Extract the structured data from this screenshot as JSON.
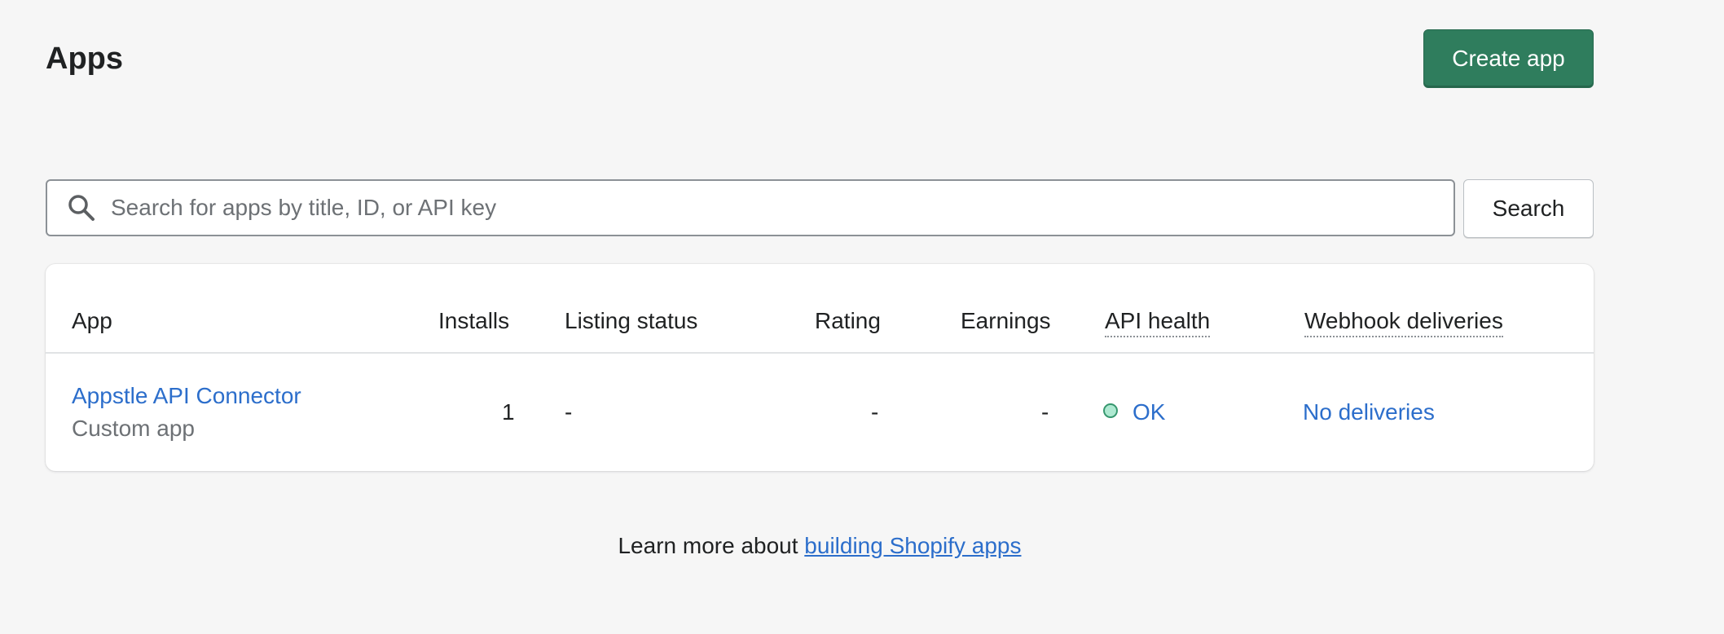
{
  "page": {
    "title": "Apps",
    "create_button_label": "Create app"
  },
  "search": {
    "placeholder": "Search for apps by title, ID, or API key",
    "value": "",
    "button_label": "Search",
    "icon": "search-icon"
  },
  "table": {
    "columns": {
      "app": "App",
      "installs": "Installs",
      "listing_status": "Listing status",
      "rating": "Rating",
      "earnings": "Earnings",
      "api_health": "API health",
      "webhook_deliveries": "Webhook deliveries"
    },
    "rows": [
      {
        "name": "Appstle API Connector",
        "type": "Custom app",
        "installs": "1",
        "listing_status": "-",
        "rating": "-",
        "earnings": "-",
        "api_health": "OK",
        "webhook_deliveries": "No deliveries"
      }
    ]
  },
  "footer": {
    "prefix": "Learn more about ",
    "link_text": "building Shopify apps"
  },
  "colors": {
    "primary_button": "#2f7d5d",
    "link": "#2c6ecb",
    "status_ok": "#36976e",
    "background": "#f6f6f6"
  }
}
